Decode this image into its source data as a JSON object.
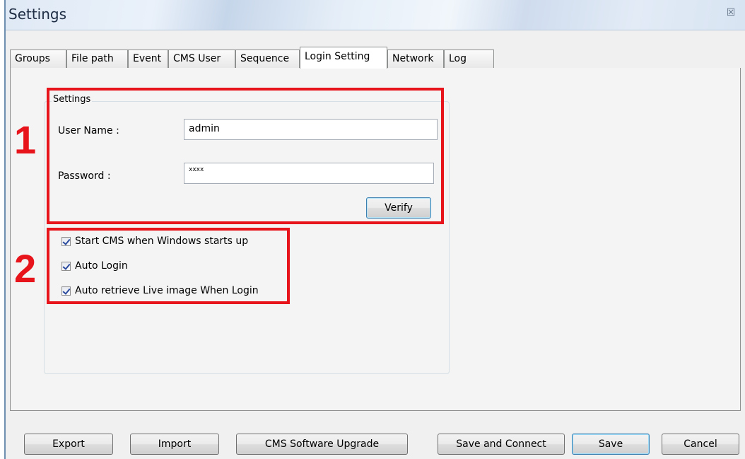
{
  "window": {
    "title": "Settings",
    "close_glyph": "☒"
  },
  "tabs": [
    {
      "label": "Groups",
      "active": false
    },
    {
      "label": "File path",
      "active": false
    },
    {
      "label": "Event",
      "active": false
    },
    {
      "label": "CMS User",
      "active": false
    },
    {
      "label": "Sequence",
      "active": false
    },
    {
      "label": "Login Setting",
      "active": true
    },
    {
      "label": "Network",
      "active": false
    },
    {
      "label": "Log",
      "active": false
    }
  ],
  "settings_group": {
    "title": "Settings",
    "username_label": "User Name :",
    "username_value": "admin",
    "password_label": "Password :",
    "password_value": "xxxx",
    "verify_label": "Verify"
  },
  "options": [
    {
      "label": "Start CMS when Windows starts up",
      "checked": true
    },
    {
      "label": "Auto Login",
      "checked": true
    },
    {
      "label": "Auto retrieve Live image When Login",
      "checked": true
    }
  ],
  "annotations": {
    "one": "1",
    "two": "2",
    "color": "#e8141c"
  },
  "footer": {
    "export_label": "Export",
    "import_label": "Import",
    "upgrade_label": "CMS Software Upgrade",
    "save_connect_label": "Save and Connect",
    "save_label": "Save",
    "cancel_label": "Cancel"
  }
}
